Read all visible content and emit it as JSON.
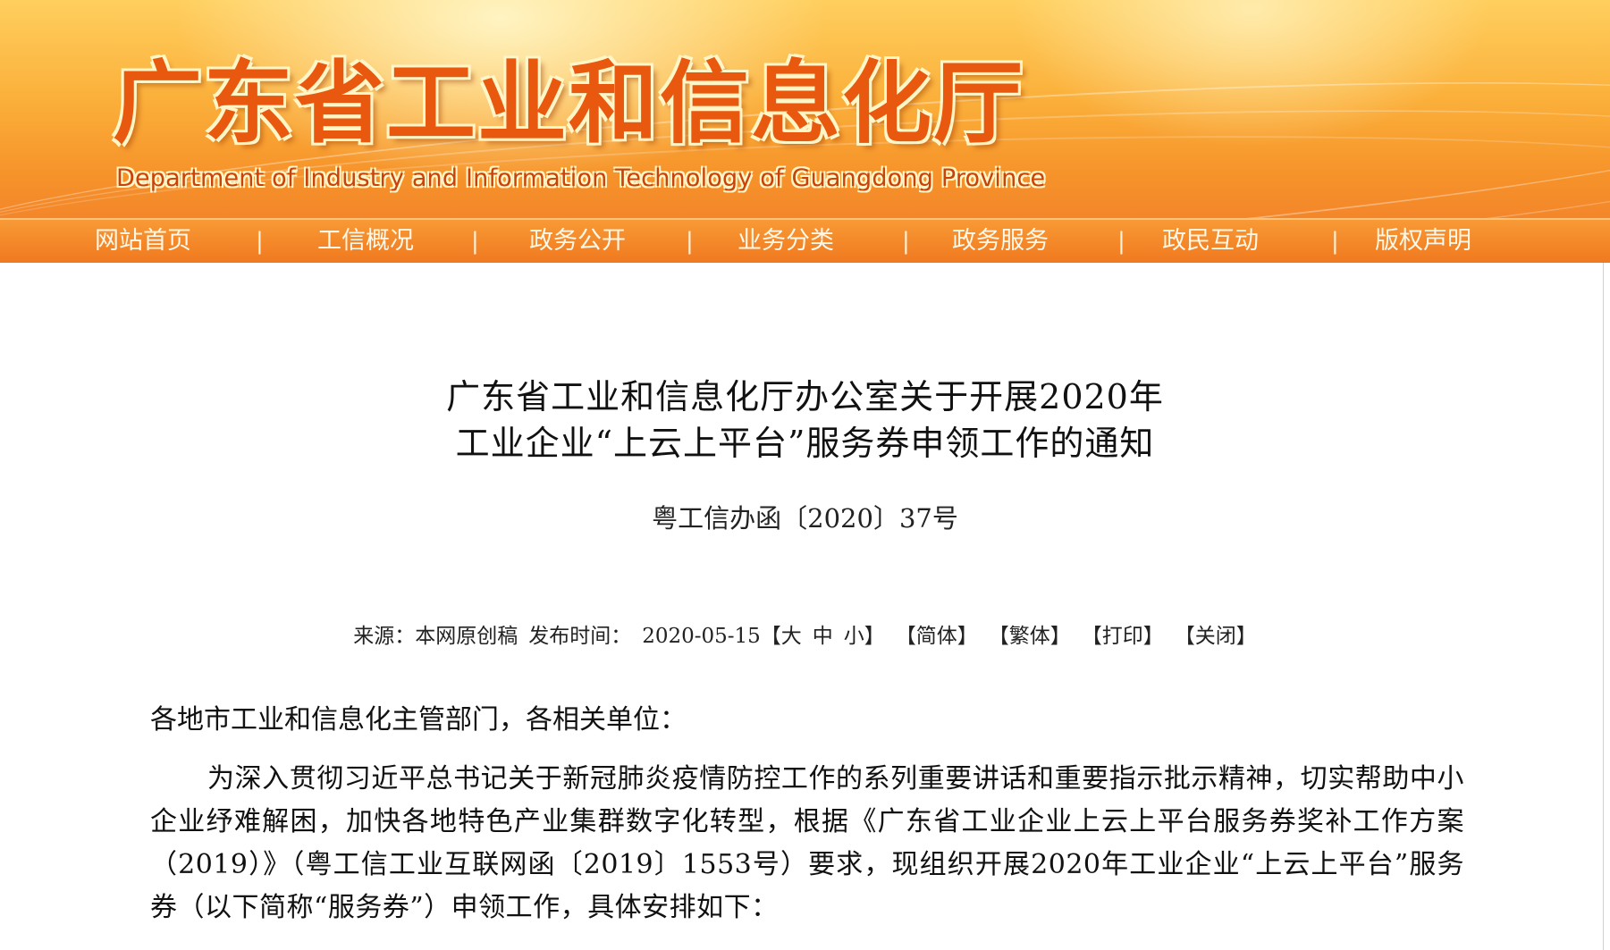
{
  "header": {
    "site_title": "广东省工业和信息化厅",
    "site_subtitle": "Department of Industry and Information Technology of Guangdong Province"
  },
  "nav": {
    "items": [
      {
        "label": "网站首页"
      },
      {
        "label": "工信概况"
      },
      {
        "label": "政务公开"
      },
      {
        "label": "业务分类"
      },
      {
        "label": "政务服务"
      },
      {
        "label": "政民互动"
      },
      {
        "label": "版权声明"
      }
    ],
    "separator": "|"
  },
  "article": {
    "title_line1": "广东省工业和信息化厅办公室关于开展2020年",
    "title_line2": "工业企业“上云上平台”服务券申领工作的通知",
    "doc_number": "粤工信办函〔2020〕37号",
    "meta": {
      "source_label": "来源：本网原创稿",
      "publish_label": "发布时间：",
      "publish_date": "2020-05-15",
      "font_size_prefix": "【",
      "font_large": "大",
      "font_medium": "中",
      "font_small": "小",
      "font_size_suffix": "】",
      "simplified": "【简体】",
      "traditional": "【繁体】",
      "print": "【打印】",
      "close": "【关闭】"
    },
    "salutation": "各地市工业和信息化主管部门，各相关单位：",
    "paragraph1": "为深入贯彻习近平总书记关于新冠肺炎疫情防控工作的系列重要讲话和重要指示批示精神，切实帮助中小企业纾难解困，加快各地特色产业集群数字化转型，根据《广东省工业企业上云上平台服务券奖补工作方案（2019）》（粤工信工业互联网函〔2019〕1553号）要求，现组织开展2020年工业企业“上云上平台”服务券（以下简称“服务券”）申领工作，具体安排如下："
  },
  "colors": {
    "banner_orange": "#f6932a",
    "title_orange": "#e8580f",
    "nav_orange": "#f0791f"
  }
}
